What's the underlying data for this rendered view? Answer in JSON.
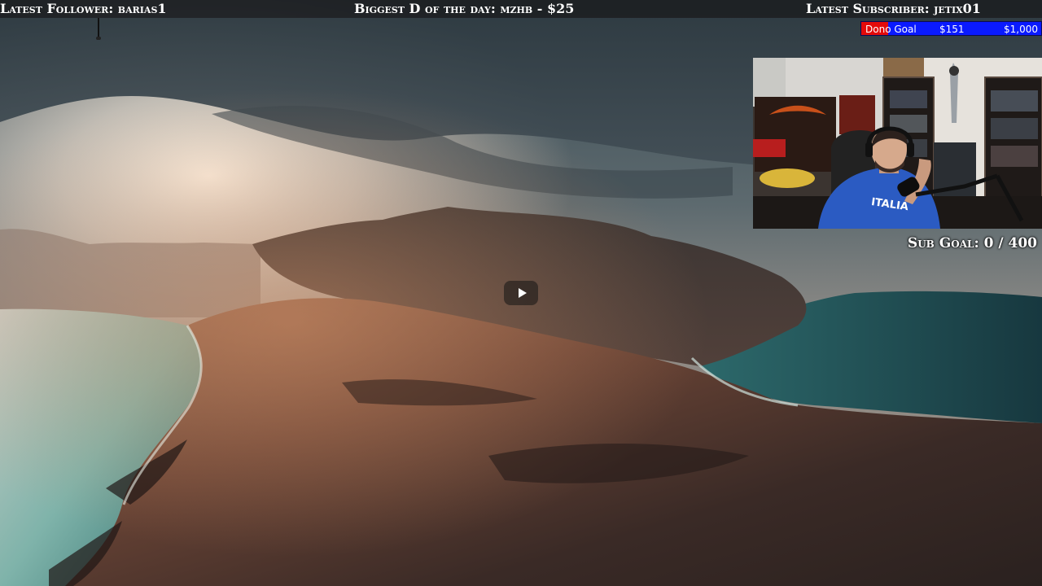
{
  "top_bar": {
    "follower": "Latest Follower: barias1",
    "donation": "Biggest D of the day: mzhb - $25",
    "subscriber": "Latest Subscriber: jetix01"
  },
  "dono_goal": {
    "title": "Dono Goal",
    "current": "$151",
    "target": "$1,000",
    "progress": 0.151,
    "fill_color": "#e30a0a",
    "bar_color": "#0a1aff"
  },
  "sub_goal": {
    "text": "Sub Goal: 0 / 400"
  },
  "player": {
    "play_icon": "play-icon"
  },
  "webcam": {
    "shirt_text": "ITALIA"
  }
}
